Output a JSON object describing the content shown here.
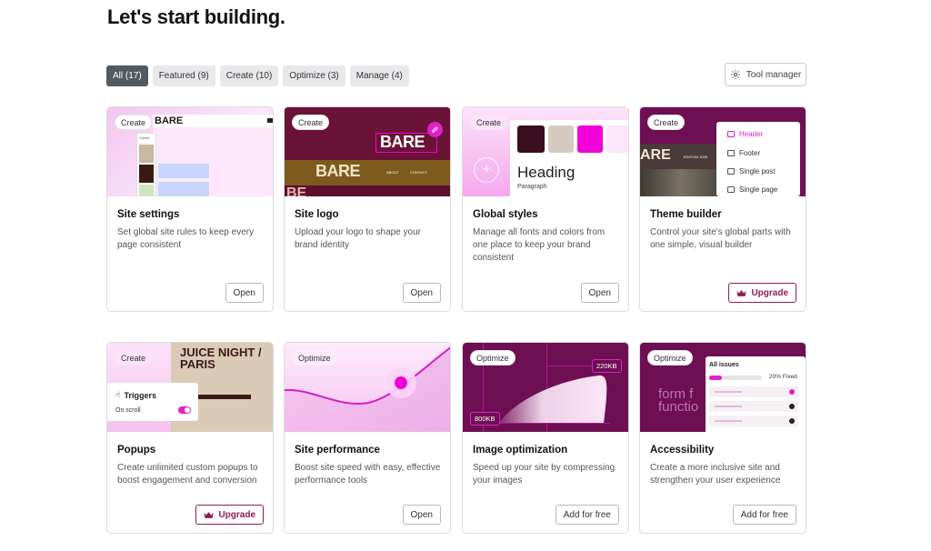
{
  "page": {
    "title": "Let's start building."
  },
  "filters": [
    {
      "label": "All (17)",
      "active": true
    },
    {
      "label": "Featured (9)"
    },
    {
      "label": "Create (10)"
    },
    {
      "label": "Optimize (3)"
    },
    {
      "label": "Manage (4)"
    }
  ],
  "tool_manager": {
    "label": "Tool manager",
    "icon": "gear-icon"
  },
  "cards": [
    {
      "badge": "Create",
      "title": "Site settings",
      "description": "Set global site rules to keep every page consistent",
      "button": "Open",
      "thumb": {
        "brand": "BARE",
        "panel_label": "Colors"
      }
    },
    {
      "badge": "Create",
      "title": "Site logo",
      "description": "Upload your logo to shape your brand identity",
      "button": "Open",
      "thumb": {
        "logo_text": "BARE",
        "big_text": "BARE",
        "nav_1": "ABOUT",
        "nav_2": "CONTACT",
        "bottom_text": "BE"
      }
    },
    {
      "badge": "Create",
      "title": "Global styles",
      "description": "Manage all fonts and colors from one place to keep your brand consistent",
      "button": "Open",
      "thumb": {
        "heading": "Heading",
        "paragraph": "Paragraph",
        "swatches": [
          "#3a0f20",
          "#d5cbc3",
          "#f200d8"
        ]
      }
    },
    {
      "badge": "Create",
      "title": "Theme builder",
      "description": "Control your site's global parts with one simple, visual builder",
      "button": "Upgrade",
      "button_icon": "crown-icon",
      "thumb": {
        "menu": [
          "Header",
          "Footer",
          "Single post",
          "Single page"
        ],
        "site_text": "ARE",
        "site_small": "EDITION 2025"
      }
    },
    {
      "badge": "Create",
      "title": "Popups",
      "description": "Create unlimited custom popups to boost engagement and conversion",
      "button": "Upgrade",
      "button_icon": "crown-icon",
      "thumb": {
        "poster_text": "JUICE NIGHT / PARIS",
        "popup_title": "Triggers",
        "popup_option": "On scroll"
      }
    },
    {
      "badge": "Optimize",
      "title": "Site performance",
      "description": "Boost site speed with easy, effective performance tools",
      "button": "Open",
      "thumb": {}
    },
    {
      "badge": "Optimize",
      "title": "Image optimization",
      "description": "Speed up your site by compressing your images",
      "button": "Add for free",
      "thumb": {
        "size_after": "220KB",
        "size_before": "800KB"
      }
    },
    {
      "badge": "Optimize",
      "title": "Accessibility",
      "description": "Create a more inclusive site and strengthen your user experience",
      "button": "Add for free",
      "thumb": {
        "panel_title": "All issues",
        "progress": "20% Fixed",
        "progress_value": 0.2,
        "bg_text": "form f\nfunctio"
      }
    }
  ],
  "colors": {
    "accent": "#f200d8",
    "brand_dark": "#8f1f4e",
    "plum": "#6d0f52"
  }
}
